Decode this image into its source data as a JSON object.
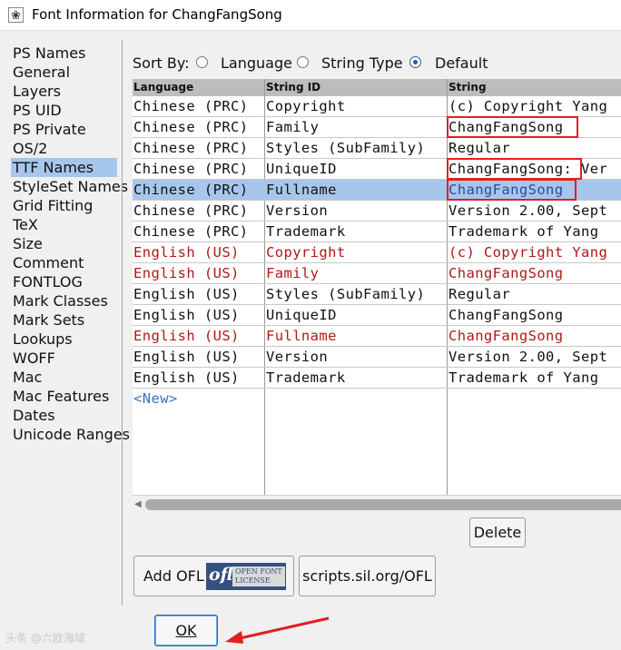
{
  "window": {
    "title": "Font Information for ChangFangSong",
    "icon": "fontforge-app-icon"
  },
  "sidebar": {
    "items": [
      {
        "label": "PS Names",
        "selected": false
      },
      {
        "label": "General",
        "selected": false
      },
      {
        "label": "Layers",
        "selected": false
      },
      {
        "label": "PS UID",
        "selected": false
      },
      {
        "label": "PS Private",
        "selected": false
      },
      {
        "label": "OS/2",
        "selected": false
      },
      {
        "label": "TTF Names",
        "selected": true
      },
      {
        "label": "StyleSet Names",
        "selected": false
      },
      {
        "label": "Grid Fitting",
        "selected": false
      },
      {
        "label": "TeX",
        "selected": false
      },
      {
        "label": "Size",
        "selected": false
      },
      {
        "label": "Comment",
        "selected": false
      },
      {
        "label": "FONTLOG",
        "selected": false
      },
      {
        "label": "Mark Classes",
        "selected": false
      },
      {
        "label": "Mark Sets",
        "selected": false
      },
      {
        "label": "Lookups",
        "selected": false
      },
      {
        "label": "WOFF",
        "selected": false
      },
      {
        "label": "Mac",
        "selected": false
      },
      {
        "label": "Mac Features",
        "selected": false
      },
      {
        "label": "Dates",
        "selected": false
      },
      {
        "label": "Unicode Ranges",
        "selected": false
      }
    ]
  },
  "sort": {
    "label": "Sort By:",
    "options": [
      {
        "label": "Language",
        "selected": false
      },
      {
        "label": "String Type",
        "selected": false
      },
      {
        "label": "Default",
        "selected": true
      }
    ]
  },
  "table": {
    "headers": [
      "Language",
      "String ID",
      "String"
    ],
    "rows": [
      {
        "language": "Chinese (PRC)",
        "string_id": "Copyright",
        "string": "(c) Copyright Yang",
        "color": "default",
        "selected": false
      },
      {
        "language": "Chinese (PRC)",
        "string_id": "Family",
        "string": "ChangFangSong",
        "color": "default",
        "selected": false
      },
      {
        "language": "Chinese (PRC)",
        "string_id": "Styles (SubFamily)",
        "string": "Regular",
        "color": "default",
        "selected": false
      },
      {
        "language": "Chinese (PRC)",
        "string_id": "UniqueID",
        "string": "ChangFangSong: Ver",
        "color": "default",
        "selected": false
      },
      {
        "language": "Chinese (PRC)",
        "string_id": "Fullname",
        "string": "ChangFangSong",
        "color": "default",
        "selected": true
      },
      {
        "language": "Chinese (PRC)",
        "string_id": "Version",
        "string": "Version 2.00, Sept",
        "color": "default",
        "selected": false
      },
      {
        "language": "Chinese (PRC)",
        "string_id": "Trademark",
        "string": "Trademark of Yang",
        "color": "default",
        "selected": false
      },
      {
        "language": "English (US)",
        "string_id": "Copyright",
        "string": "(c) Copyright Yang",
        "color": "red",
        "selected": false
      },
      {
        "language": "English (US)",
        "string_id": "Family",
        "string": "ChangFangSong",
        "color": "red",
        "selected": false
      },
      {
        "language": "English (US)",
        "string_id": "Styles (SubFamily)",
        "string": "Regular",
        "color": "default",
        "selected": false
      },
      {
        "language": "English (US)",
        "string_id": "UniqueID",
        "string": "ChangFangSong",
        "color": "default",
        "selected": false
      },
      {
        "language": "English (US)",
        "string_id": "Fullname",
        "string": "ChangFangSong",
        "color": "red",
        "selected": false
      },
      {
        "language": "English (US)",
        "string_id": "Version",
        "string": "Version 2.00, Sept",
        "color": "default",
        "selected": false
      },
      {
        "language": "English (US)",
        "string_id": "Trademark",
        "string": "Trademark of Yang",
        "color": "default",
        "selected": false
      }
    ],
    "new_label": "<New>",
    "highlight_color": "#e02020",
    "modified_text_color": "#b01818"
  },
  "buttons": {
    "delete": "Delete",
    "add_ofl": "Add OFL",
    "ofl_badge_big": "ofl",
    "ofl_badge_small": "OPEN FONT LICENSE",
    "scripts": "scripts.sil.org/OFL",
    "ok": "OK"
  },
  "watermark": "头条 @六欧海域"
}
